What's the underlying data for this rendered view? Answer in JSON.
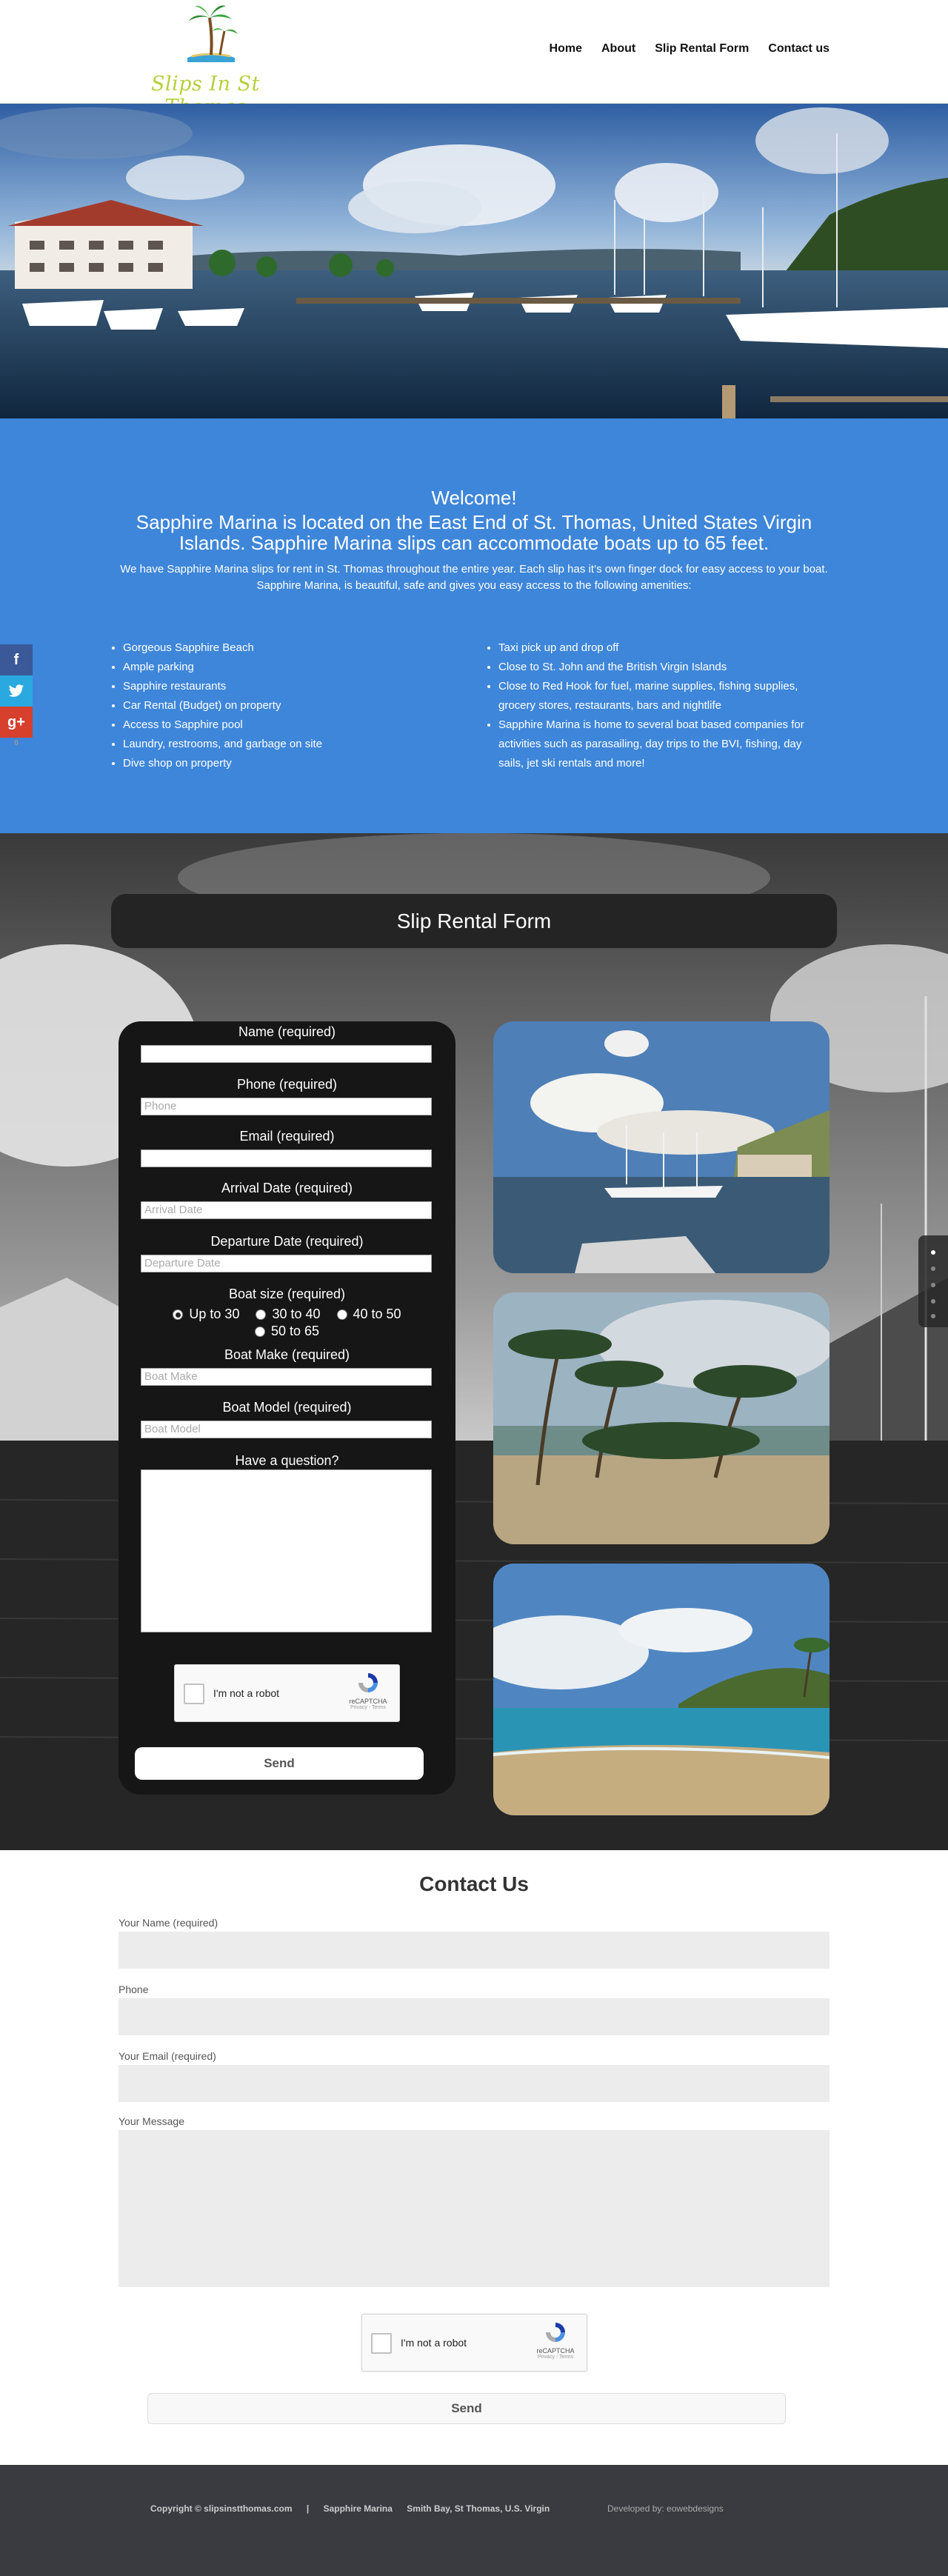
{
  "header": {
    "logo_text": "Slips In St Thomas",
    "nav": [
      "Home",
      "About",
      "Slip Rental Form",
      "Contact us"
    ]
  },
  "welcome": {
    "title": "Welcome!",
    "subtitle": "Sapphire Marina is located on the East End of St. Thomas, United States Virgin Islands. Sapphire Marina slips can accommodate boats up to 65 feet.",
    "body": "We have Sapphire Marina slips for rent in St. Thomas throughout the entire year. Each slip has it’s own finger dock for easy access to your boat. Sapphire Marina, is beautiful, safe and gives you easy access to the following amenities:",
    "amenities_left": [
      "Gorgeous Sapphire Beach",
      "Ample parking",
      "Sapphire restaurants",
      "Car Rental (Budget) on property",
      "Access to Sapphire pool",
      "Laundry, restrooms, and garbage on site",
      "Dive shop on property"
    ],
    "amenities_right": [
      "Taxi pick up and drop off",
      "Close to St. John and the British Virgin Islands",
      "Close to Red Hook for fuel, marine supplies, fishing supplies, grocery stores, restaurants, bars and nightlife",
      "Sapphire Marina is home to several boat based companies for activities such as parasailing, day trips to the BVI, fishing, day sails,  jet ski  rentals and more!"
    ]
  },
  "social": {
    "facebook": "f",
    "twitter_icon": "twitter-icon",
    "googleplus": "g+",
    "count": "0"
  },
  "rental": {
    "title": "Slip Rental Form",
    "name_label": "Name (required)",
    "phone_label": "Phone (required)",
    "phone_placeholder": "Phone",
    "email_label": "Email (required)",
    "arrival_label": "Arrival Date (required)",
    "arrival_placeholder": "Arrival Date",
    "departure_label": "Departure Date (required)",
    "departure_placeholder": "Departure Date",
    "boat_size_label": "Boat size (required)",
    "boat_sizes": [
      "Up to 30",
      "30 to 40",
      "40 to 50",
      "50 to 65"
    ],
    "selected_size": "Up to 30",
    "boat_make_label": "Boat Make (required)",
    "boat_make_placeholder": "Boat Make",
    "boat_model_label": "Boat Model (required)",
    "boat_model_placeholder": "Boat Model",
    "question_label": "Have a question?",
    "captcha_label": "I'm not a robot",
    "captcha_brand": "reCAPTCHA",
    "captcha_terms": "Privacy - Terms",
    "send_label": "Send"
  },
  "contact": {
    "title": "Contact Us",
    "name_label": "Your Name (required)",
    "phone_label": "Phone",
    "email_label": "Your Email (required)",
    "message_label": "Your Message",
    "captcha_label": "I'm not a robot",
    "captcha_brand": "reCAPTCHA",
    "captcha_terms": "Privacy - Terms",
    "send_label": "Send"
  },
  "footer": {
    "copyright": "Copyright © slipsinstthomas.com",
    "separator": "|",
    "marina": "Sapphire Marina",
    "address": "Smith Bay, St Thomas, U.S. Virgin",
    "developer": "Developed by: eowebdesigns"
  },
  "colors": {
    "welcome_bg": "#3e86d9",
    "footer_bg": "#3a3b40",
    "logo_green": "#b8cf3c"
  }
}
